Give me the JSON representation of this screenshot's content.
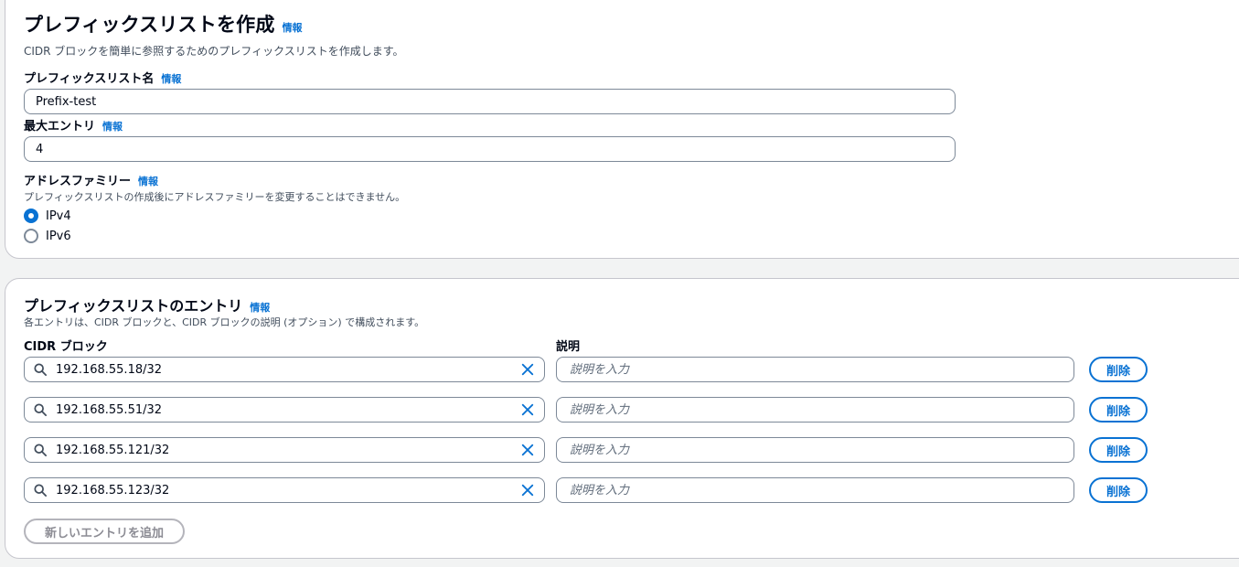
{
  "header": {
    "title": "プレフィックスリストを作成",
    "info": "情報",
    "description": "CIDR ブロックを簡単に参照するためのプレフィックスリストを作成します。"
  },
  "fields": {
    "name": {
      "label": "プレフィックスリスト名",
      "info": "情報",
      "value": "Prefix-test"
    },
    "max_entries": {
      "label": "最大エントリ",
      "info": "情報",
      "value": "4"
    },
    "address_family": {
      "label": "アドレスファミリー",
      "info": "情報",
      "description": "プレフィックスリストの作成後にアドレスファミリーを変更することはできません。",
      "options": [
        {
          "label": "IPv4",
          "selected": true
        },
        {
          "label": "IPv6",
          "selected": false
        }
      ]
    }
  },
  "entries": {
    "title": "プレフィックスリストのエントリ",
    "info": "情報",
    "description": "各エントリは、CIDR ブロックと、CIDR ブロックの説明 (オプション) で構成されます。",
    "cidr_label": "CIDR ブロック",
    "desc_label": "説明",
    "desc_placeholder": "説明を入力",
    "delete_label": "削除",
    "rows": [
      {
        "cidr": "192.168.55.18/32"
      },
      {
        "cidr": "192.168.55.51/32"
      },
      {
        "cidr": "192.168.55.121/32"
      },
      {
        "cidr": "192.168.55.123/32"
      }
    ],
    "add_button": "新しいエントリを追加"
  },
  "colors": {
    "accent": "#0972d3",
    "border": "#7d8998",
    "disabled": "#8c8c94"
  },
  "icons": [
    "search-icon",
    "clear-icon"
  ]
}
